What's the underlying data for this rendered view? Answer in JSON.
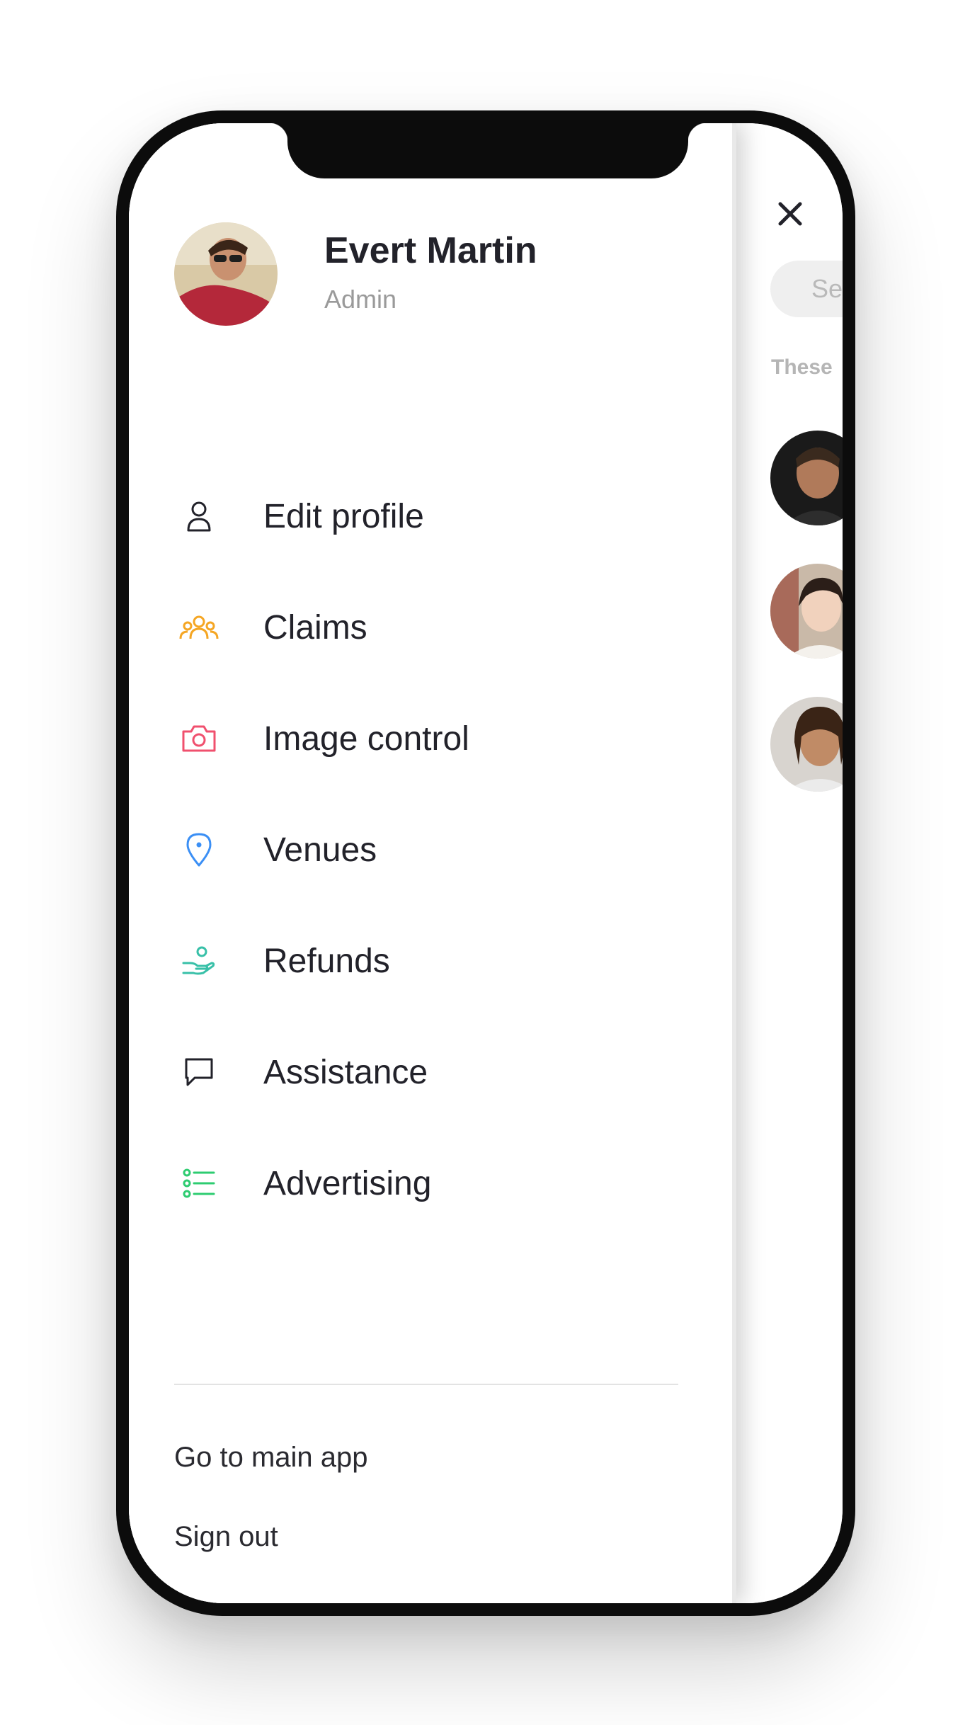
{
  "user": {
    "name": "Evert Martin",
    "role": "Admin"
  },
  "menu": {
    "items": [
      {
        "label": "Edit profile",
        "icon": "user-icon",
        "color": "#22222a"
      },
      {
        "label": "Claims",
        "icon": "group-icon",
        "color": "#f5a623"
      },
      {
        "label": "Image control",
        "icon": "camera-icon",
        "color": "#f0506e"
      },
      {
        "label": "Venues",
        "icon": "location-pin-icon",
        "color": "#3b8ff5"
      },
      {
        "label": "Refunds",
        "icon": "hand-coin-icon",
        "color": "#38c0a8"
      },
      {
        "label": "Assistance",
        "icon": "chat-bubble-icon",
        "color": "#22222a"
      },
      {
        "label": "Advertising",
        "icon": "list-icon",
        "color": "#2ecc71"
      }
    ]
  },
  "footer": {
    "main_app_label": "Go to main app",
    "sign_out_label": "Sign out"
  },
  "background_page": {
    "search_placeholder_visible": "Se",
    "section_hint_visible": "These"
  }
}
